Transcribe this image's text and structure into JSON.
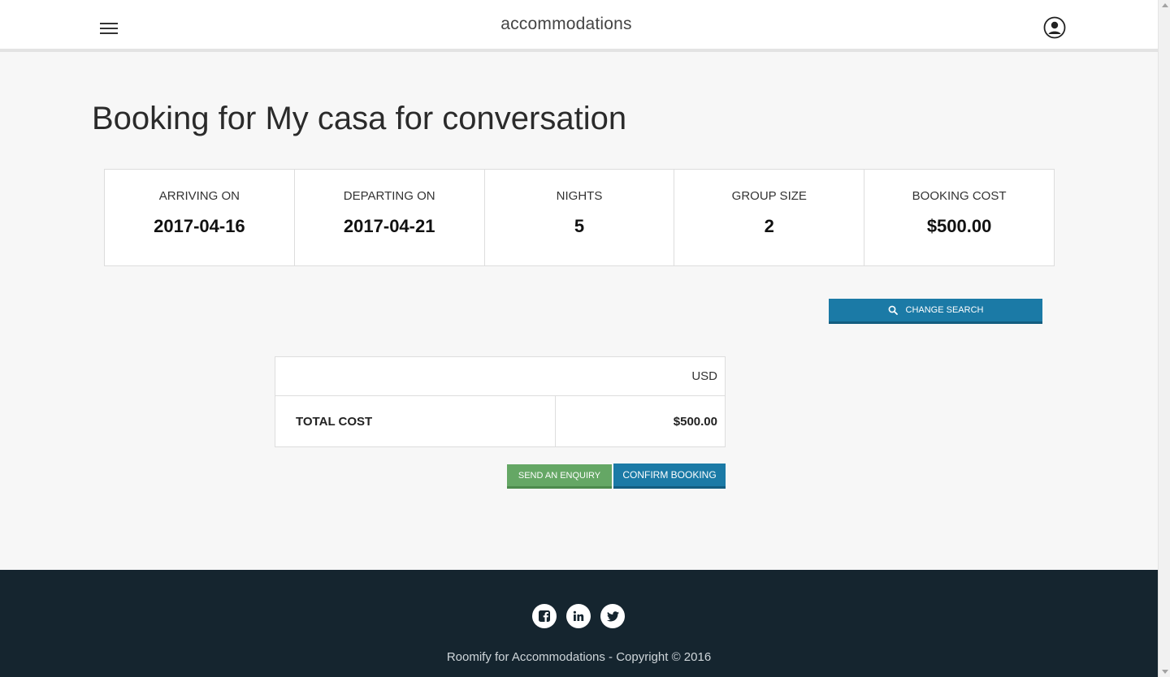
{
  "header": {
    "title": "accommodations"
  },
  "page_title": "Booking for My casa for conversation",
  "summary": [
    {
      "label": "ARRIVING ON",
      "value": "2017-04-16"
    },
    {
      "label": "DEPARTING ON",
      "value": "2017-04-21"
    },
    {
      "label": "NIGHTS",
      "value": "5"
    },
    {
      "label": "GROUP SIZE",
      "value": "2"
    },
    {
      "label": "BOOKING COST",
      "value": "$500.00"
    }
  ],
  "change_search_label": "CHANGE SEARCH",
  "cost_table": {
    "currency": "USD",
    "total_label": "TOTAL COST",
    "total_value": "$500.00"
  },
  "actions": {
    "enquiry_label": "SEND AN ENQUIRY",
    "confirm_label": "CONFIRM BOOKING"
  },
  "footer": {
    "social_icons": [
      "facebook-icon",
      "linkedin-icon",
      "twitter-icon"
    ],
    "copyright": "Roomify for Accommodations - Copyright © 2016"
  },
  "colors": {
    "primary": "#1b7aa6",
    "success": "#65a765",
    "footer_bg": "#15252f"
  }
}
